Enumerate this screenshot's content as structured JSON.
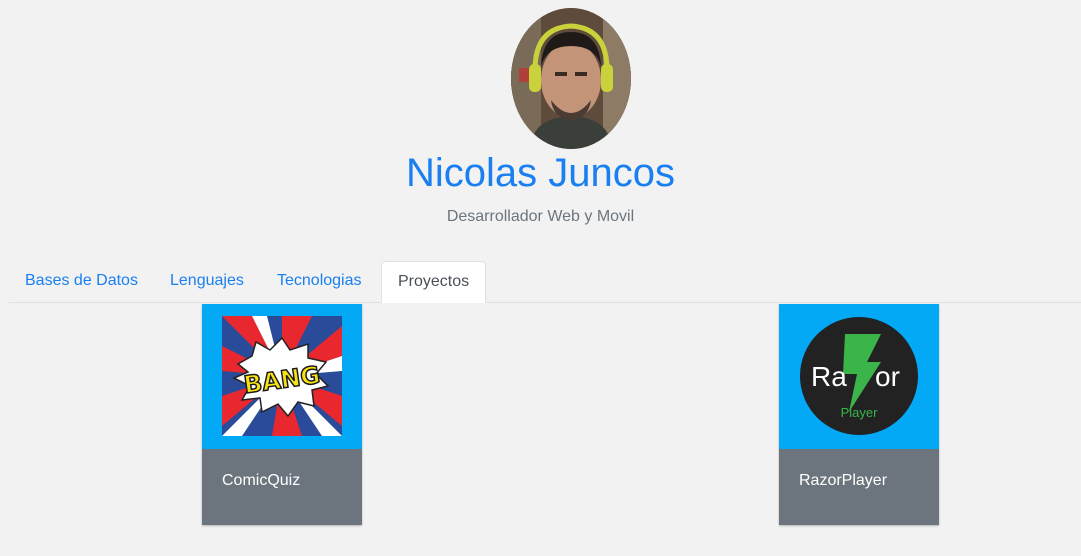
{
  "profile": {
    "name": "Nicolas Juncos",
    "role": "Desarrollador Web y Movil"
  },
  "tabs": [
    {
      "label": "Bases de Datos",
      "active": false
    },
    {
      "label": "Lenguajes",
      "active": false
    },
    {
      "label": "Tecnologias",
      "active": false
    },
    {
      "label": "Proyectos",
      "active": true
    }
  ],
  "projects": [
    {
      "title": "ComicQuiz",
      "icon_text": "BANG",
      "icon": "comic-bang-icon"
    },
    {
      "title": "RazorPlayer",
      "icon_text_left": "Ra",
      "icon_text_right": "or",
      "icon_subtext": "Player",
      "icon": "razor-bolt-icon"
    }
  ],
  "colors": {
    "accent": "#1a7ff0",
    "card_top": "#03a9f4",
    "card_bottom": "#6c757d",
    "background": "#f2f2f2"
  }
}
